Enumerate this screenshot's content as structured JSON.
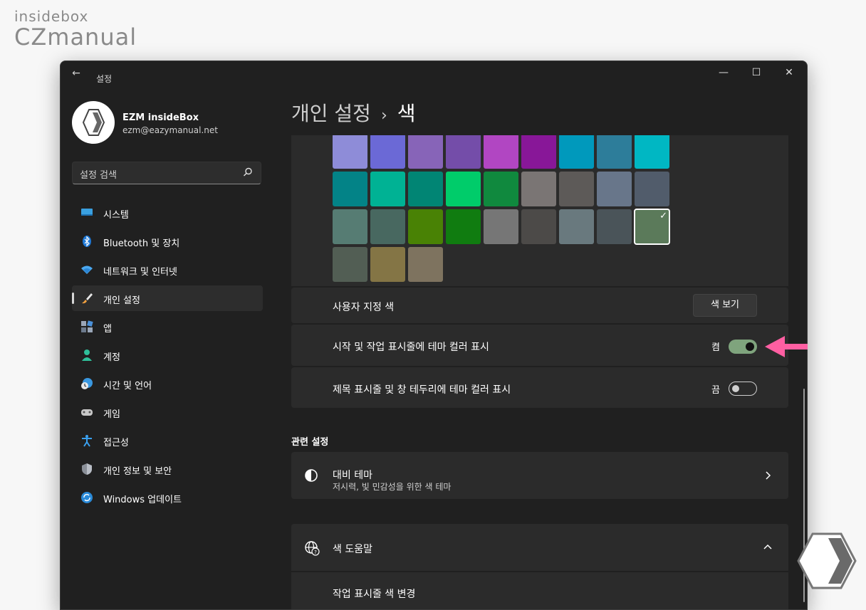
{
  "watermark": {
    "top": "insidebox",
    "bottom": "CZmanual"
  },
  "window": {
    "title": "설정",
    "controls": {
      "minimize": "—",
      "maximize": "☐",
      "close": "✕"
    }
  },
  "profile": {
    "name": "EZM insideBox",
    "email": "ezm@eazymanual.net"
  },
  "search": {
    "placeholder": "설정 검색"
  },
  "nav": [
    {
      "label": "시스템",
      "icon": "system-icon"
    },
    {
      "label": "Bluetooth 및 장치",
      "icon": "bluetooth-icon"
    },
    {
      "label": "네트워크 및 인터넷",
      "icon": "wifi-icon"
    },
    {
      "label": "개인 설정",
      "icon": "brush-icon",
      "active": true
    },
    {
      "label": "앱",
      "icon": "apps-icon"
    },
    {
      "label": "계정",
      "icon": "account-icon"
    },
    {
      "label": "시간 및 언어",
      "icon": "clock-globe-icon"
    },
    {
      "label": "게임",
      "icon": "gamepad-icon"
    },
    {
      "label": "접근성",
      "icon": "accessibility-icon"
    },
    {
      "label": "개인 정보 및 보안",
      "icon": "shield-icon"
    },
    {
      "label": "Windows 업데이트",
      "icon": "update-icon"
    }
  ],
  "breadcrumb": {
    "parent": "개인 설정",
    "separator": "›",
    "current": "색"
  },
  "accent_colors": [
    [
      "#8e8cd8",
      "#6b69d6",
      "#8764b8",
      "#744da9",
      "#b146c2",
      "#881798",
      "#0099bc",
      "#2d7d9a",
      "#00b7c3"
    ],
    [
      "#038387",
      "#00b294",
      "#018574",
      "#00cc6a",
      "#10893e",
      "#7a7574",
      "#5d5a58",
      "#68768a",
      "#515c6b"
    ],
    [
      "#567c73",
      "#486860",
      "#498205",
      "#107c10",
      "#767676",
      "#4c4a48",
      "#69797e",
      "#4a5459",
      "#5b7a5a"
    ],
    [
      "#525e54",
      "#847545",
      "#7e735f"
    ]
  ],
  "selected_color": "#5b7a5a",
  "check_glyph": "✓",
  "custom_color": {
    "label": "사용자 지정 색",
    "button": "색 보기"
  },
  "start_taskbar_accent": {
    "label": "시작 및 작업 표시줄에 테마 컬러 표시",
    "state": "켬",
    "on": true
  },
  "titlebar_accent": {
    "label": "제목 표시줄 및 창 테두리에 테마 컬러 표시",
    "state": "끔",
    "on": false
  },
  "related": {
    "heading": "관련 설정",
    "contrast": {
      "title": "대비 테마",
      "subtitle": "저시력, 빛 민감성을 위한 색 테마",
      "icon": "contrast-icon"
    }
  },
  "help": {
    "title": "색 도움말",
    "icon": "globe-help-icon",
    "item": "작업 표시줄 색 변경"
  },
  "colors": {
    "window_bg": "#202020",
    "card_bg": "#2b2b2b",
    "toggle_on": "#7fa47d",
    "pointer_arrow": "#ff5fa2"
  }
}
